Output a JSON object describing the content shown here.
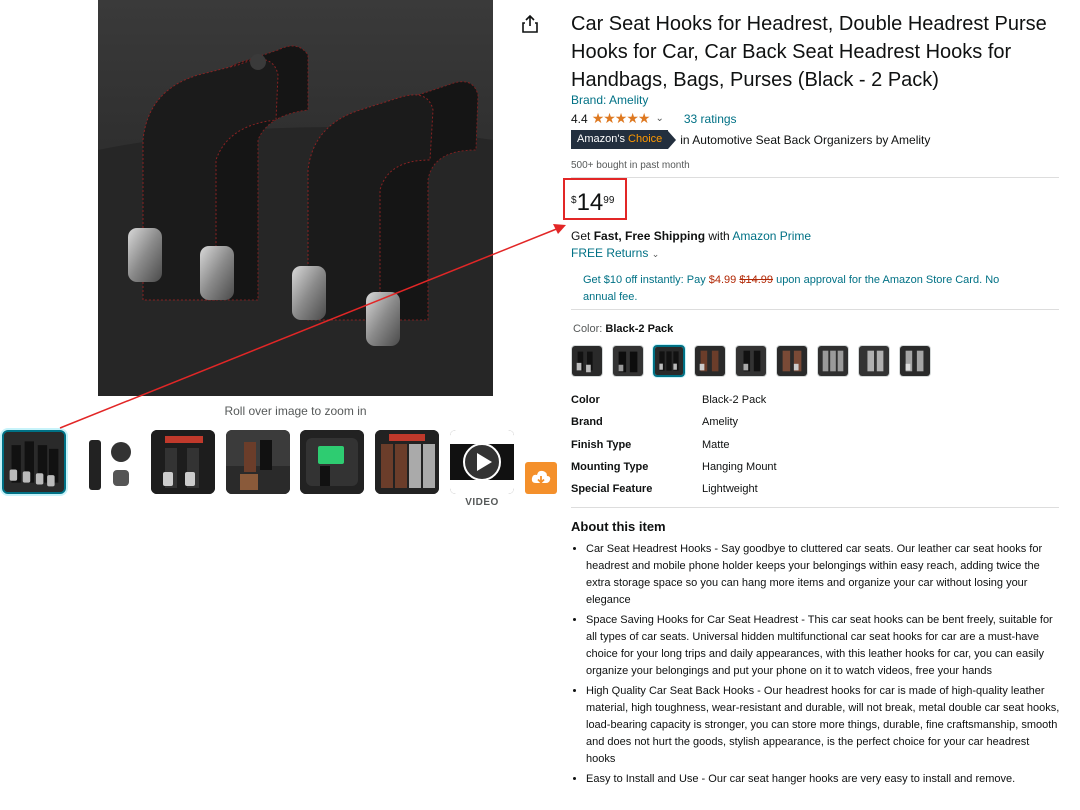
{
  "gallery": {
    "zoom_hint": "Roll over image to zoom in",
    "video_label": "VIDEO",
    "thumbnail_count": 7
  },
  "product": {
    "title": "Car Seat Hooks for Headrest, Double Headrest Purse Hooks for Car, Car Back Seat Headrest Hooks for Handbags, Bags, Purses (Black - 2 Pack)",
    "brand_link": "Brand: Amelity",
    "rating_value": "4.4",
    "stars": "★★★★★",
    "ratings_count": "33 ratings",
    "badge_part1": "Amazon's",
    "badge_part2": "Choice",
    "badge_category": "in Automotive Seat Back Organizers by Amelity",
    "bought": "500+ bought in past month"
  },
  "price": {
    "symbol": "$",
    "whole": "14",
    "fraction": "99"
  },
  "shipping": {
    "prefix": "Get ",
    "bold": "Fast, Free Shipping",
    "middle": " with ",
    "prime_link": "Amazon Prime",
    "returns": "FREE Returns"
  },
  "card_offer": {
    "text1": "Get $10 off instantly: Pay ",
    "new_price": "$4.99",
    "old_price": "$14.99",
    "text2": " upon approval for the Amazon Store Card. No annual fee."
  },
  "color": {
    "label": "Color: ",
    "selected": "Black-2 Pack",
    "swatch_count": 9
  },
  "specs": [
    {
      "key": "Color",
      "value": "Black-2 Pack"
    },
    {
      "key": "Brand",
      "value": "Amelity"
    },
    {
      "key": "Finish Type",
      "value": "Matte"
    },
    {
      "key": "Mounting Type",
      "value": "Hanging Mount"
    },
    {
      "key": "Special Feature",
      "value": "Lightweight"
    }
  ],
  "about": {
    "title": "About this item",
    "bullets": [
      "Car Seat Headrest Hooks - Say goodbye to cluttered car seats. Our leather car seat hooks for headrest and mobile phone holder keeps your belongings within easy reach, adding twice the extra storage space so you can hang more items and organize your car without losing your elegance",
      "Space Saving Hooks for Car Seat Headrest - This car seat hooks can be bent freely, suitable for all types of car seats. Universal hidden multifunctional car seat hooks for car are a must-have choice for your long trips and daily appearances, with this leather hooks for car, you can easily organize your belongings and put your phone on it to watch videos, free your hands",
      "High Quality Car Seat Back Hooks - Our headrest hooks for car is made of high-quality leather material, high toughness, wear-resistant and durable, will not break, metal double car seat hooks, load-bearing capacity is stronger, you can store more things, durable, fine craftsmanship, smooth and does not hurt the goods, stylish appearance, is the perfect choice for your car headrest hooks",
      "Easy to Install and Use - Our car seat hanger hooks are very easy to install and remove."
    ]
  },
  "icons": {
    "share": "share-icon",
    "play": "play-icon",
    "download": "download-icon"
  },
  "colors": {
    "link": "#007185",
    "star": "#de7921",
    "price_red": "#b12704",
    "annotation": "#e22626",
    "download_btn": "#f4902b"
  }
}
